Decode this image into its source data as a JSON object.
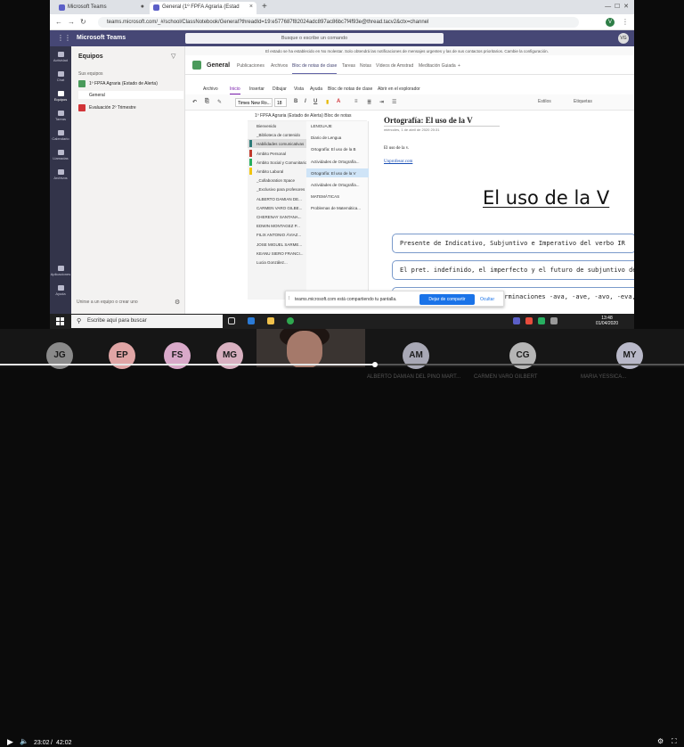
{
  "browser": {
    "tabs": [
      {
        "title": "Microsoft Teams"
      },
      {
        "title": "General (1º FPFA Agraria (Estad"
      }
    ],
    "new_tab": "+",
    "url": "teams.microsoft.com/_#/school/ClassNotebook/General?threadId=19:e577687f82024adc897ac86bc7f4f93e@thread.tacv2&ctx=channel",
    "profile_initial": "V"
  },
  "teams": {
    "brand": "Microsoft Teams",
    "search_placeholder": "Busque o escribe un comando",
    "user_initials": "VG",
    "rail": [
      "Actividad",
      "Chat",
      "Equipos",
      "Tareas",
      "Calendario",
      "Llamadas",
      "Archivos",
      "Aplicaciones",
      "Ayuda"
    ],
    "teams_header": "Equipos",
    "your_teams_label": "Sus equipos",
    "teams_list": [
      {
        "name": "1º FPFA Agraria (Estado de Alerta)",
        "color": "#4a9a5b",
        "channel": "General"
      },
      {
        "name": "Evaluación 2º Trimestre",
        "color": "#d13438"
      }
    ],
    "join_label": "Unirse a un equipo o crear uno",
    "banner": "El estado se ha establecido en No molestar. Solo obtendrá las notificaciones de mensajes urgentes y las de sus contactos prioritarios. Cambie la configuración.",
    "channel": {
      "name": "General",
      "tabs": [
        "Publicaciones",
        "Archivos",
        "Bloc de notas de clase",
        "Tareas",
        "Notas",
        "Vídeos de Amstrad",
        "Meditación Guiada",
        "+"
      ],
      "selected_tab": 2
    }
  },
  "onenote": {
    "menu": [
      "Archivo",
      "Inicio",
      "Insertar",
      "Dibujar",
      "Vista",
      "Ayuda",
      "Bloc de notas de clase",
      "Abrir en el explorador"
    ],
    "selected_menu": 1,
    "font": "Times New Ro...",
    "font_size": "18",
    "styles_label": "Estilos",
    "tags_label": "Etiquetas",
    "notebook": "1º FPFA Agraria (Estado de Alerta) Bloc de notas",
    "sections": [
      {
        "name": "Bienvenido",
        "color": ""
      },
      {
        "name": "_Biblioteca de contenido",
        "color": ""
      },
      {
        "name": "Habilidades comunicativas",
        "color": "#2b7a78"
      },
      {
        "name": "Ámbito Personal",
        "color": "#c0392b"
      },
      {
        "name": "Ámbito Social y Comunitario",
        "color": "#27ae60"
      },
      {
        "name": "Ámbito Laboral",
        "color": "#f1c40f"
      },
      {
        "name": "_Collaboration Space",
        "color": ""
      },
      {
        "name": "_Exclusivo para profesores",
        "color": ""
      },
      {
        "name": "ALBERTO DAMIAN DE...",
        "color": ""
      },
      {
        "name": "CARMEN VARO GILBE...",
        "color": ""
      },
      {
        "name": "CHERENAY SANTANA...",
        "color": ""
      },
      {
        "name": "EDWIN MONTAGEZ P...",
        "color": ""
      },
      {
        "name": "FILIX ANTONIO ÁVIAZ...",
        "color": ""
      },
      {
        "name": "JOSE MIGUEL SARME...",
        "color": ""
      },
      {
        "name": "KEANU SIERO FRANCI...",
        "color": ""
      },
      {
        "name": "Lucia González...",
        "color": ""
      }
    ],
    "selected_section": 2,
    "pages": [
      "LENGUAJE",
      "Diario de Lengua",
      "Ortografía: El uso de la B",
      "Actividades de Ortografía...",
      "Ortografía: El uso de la V",
      "Actividades de Ortografía...",
      "MATEMÁTICAS",
      "Problemas de Matemática..."
    ],
    "selected_page": 4,
    "page": {
      "title": "Ortografía: El uso de la V",
      "date": "miércoles, 1 de abril de 2020     20:31",
      "text": "El uso de la v.",
      "link": "Unprofesor.com",
      "big_title": "El uso de la V",
      "rules": [
        "Presente de Indicativo, Subjuntivo e Imperativo del verbo IR",
        "El pret. indefinido, el imperfecto y el futuro de subjuntivo de ESTAR, AND",
        "Las terminaciones -ava, -ave, -avo, -eva, -eve, -evo, -iva, -ive"
      ]
    }
  },
  "sharing": {
    "text": "teams.microsoft.com está compartiendo tu pantalla.",
    "stop_label": "Dejar de compartir",
    "hide_label": "Ocultar"
  },
  "taskbar": {
    "search_placeholder": "Escribe aquí para buscar",
    "time": "13:48",
    "date": "01/04/2020"
  },
  "participants": [
    {
      "initials": "JG",
      "color": "#8a8a8a",
      "name": ""
    },
    {
      "initials": "EP",
      "color": "#e0a5a5",
      "name": ""
    },
    {
      "initials": "FS",
      "color": "#d9a9c9",
      "name": ""
    },
    {
      "initials": "MG",
      "color": "#d8b0c0",
      "name": ""
    },
    {
      "initials": "AM",
      "color": "#a8a8b5",
      "name": "ALBERTO DAMIAN DEL PINO MART..."
    },
    {
      "initials": "CG",
      "color": "#b5b5b5",
      "name": "CARMEN VARO GILBERT"
    },
    {
      "initials": "MY",
      "color": "#b8b8c8",
      "name": "MARIA YESSICA..."
    }
  ],
  "player": {
    "current": "23:02",
    "separator": "/",
    "total": "42:02",
    "progress": 0.548
  },
  "colors": {
    "teams_purple": "#464775",
    "onenote_purple": "#7719aa",
    "share_blue": "#1a73e8"
  }
}
